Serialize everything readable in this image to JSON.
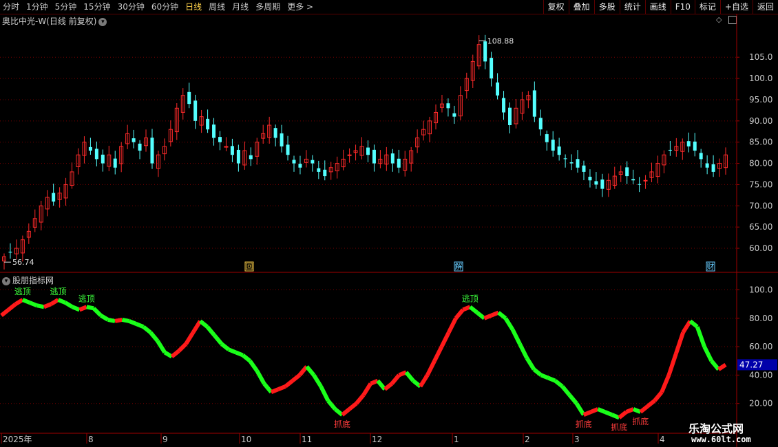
{
  "toolbar": {
    "periods": [
      "分时",
      "1分钟",
      "5分钟",
      "15分钟",
      "30分钟",
      "60分钟",
      "日线",
      "周线",
      "月线",
      "多周期",
      "更多 >"
    ],
    "active_period": "日线",
    "tools": [
      "复权",
      "叠加",
      "多股",
      "统计",
      "画线",
      "F10",
      "标记",
      "+自选",
      "返回"
    ]
  },
  "main_chart": {
    "title": "奥比中光-W(日线 前复权)",
    "y_ticks": [
      "105.0",
      "100.0",
      "95.00",
      "90.00",
      "85.00",
      "80.00",
      "75.00",
      "70.00",
      "65.00",
      "60.00"
    ],
    "max_label": "108.88",
    "min_label": "56.74",
    "markers": [
      {
        "text": "回",
        "color": "#ffd24a"
      },
      {
        "text": "解",
        "color": "#66ccff"
      },
      {
        "text": "财",
        "color": "#66ccff"
      }
    ]
  },
  "indicator": {
    "title": "股朋指标网",
    "y_ticks": [
      "100.0",
      "80.00",
      "60.00",
      "40.00",
      "20.00"
    ],
    "current_value": "47.27",
    "label_top": "逃顶",
    "label_bottom": "抓底"
  },
  "x_axis": {
    "labels": [
      "2025年",
      "8",
      "9",
      "10",
      "11",
      "12",
      "1",
      "2",
      "3",
      "4"
    ]
  },
  "watermark": {
    "line1": "乐淘公式网",
    "line2": "www.60lt.com"
  },
  "colors": {
    "up": "#ff2a2a",
    "down": "#54ffff",
    "ind_up": "#ff1a1a",
    "ind_down": "#1aff1a",
    "grid": "#7a0000",
    "axis": "#a00000"
  },
  "chart_data": [
    {
      "type": "candlestick",
      "title": "奥比中光-W(日线 前复权)",
      "ylim": [
        54.5,
        112
      ],
      "x_labels": [
        "2025年",
        "8",
        "9",
        "10",
        "11",
        "12",
        "1",
        "2",
        "3",
        "4"
      ],
      "close_series": [
        58,
        59,
        60,
        62,
        64,
        67,
        70,
        72,
        71,
        73,
        75,
        78,
        82,
        85,
        83,
        81,
        80,
        82,
        79,
        84,
        87,
        85,
        83,
        86,
        80,
        82,
        84,
        88,
        93,
        96,
        94,
        90,
        91,
        88,
        86,
        85,
        84,
        82,
        80,
        83,
        81,
        85,
        87,
        89,
        86,
        84,
        82,
        80,
        79,
        81,
        80,
        78,
        77,
        79,
        80,
        81,
        82,
        83,
        84,
        82,
        80,
        81,
        82,
        80,
        79,
        81,
        83,
        86,
        88,
        90,
        92,
        94,
        93,
        91,
        96,
        100,
        104,
        108,
        104,
        100,
        96,
        92,
        89,
        93,
        95,
        96,
        91,
        88,
        85,
        83,
        82,
        81,
        80,
        79,
        78,
        76,
        75,
        74,
        76,
        77,
        78,
        77,
        76,
        75,
        76,
        78,
        80,
        82,
        83,
        84,
        85,
        84,
        83,
        81,
        79,
        78,
        80,
        82
      ],
      "max": 108.88,
      "min": 56.74
    },
    {
      "type": "line",
      "title": "股朋指标网",
      "ylim": [
        0,
        108
      ],
      "values": [
        82,
        86,
        90,
        93,
        91,
        89,
        88,
        90,
        93,
        91,
        88,
        86,
        88,
        87,
        82,
        79,
        78,
        79,
        78,
        76,
        74,
        70,
        64,
        56,
        53,
        57,
        62,
        70,
        78,
        74,
        68,
        62,
        58,
        56,
        54,
        50,
        43,
        34,
        28,
        30,
        32,
        36,
        40,
        46,
        40,
        32,
        22,
        16,
        12,
        16,
        20,
        26,
        34,
        36,
        30,
        34,
        40,
        42,
        36,
        32,
        40,
        50,
        60,
        70,
        80,
        86,
        88,
        84,
        80,
        82,
        84,
        80,
        72,
        62,
        52,
        44,
        40,
        38,
        36,
        32,
        26,
        20,
        12,
        14,
        16,
        14,
        12,
        10,
        14,
        16,
        14,
        18,
        22,
        28,
        40,
        55,
        70,
        78,
        74,
        60,
        50,
        44,
        47.27
      ],
      "current": 47.27,
      "annotations": [
        {
          "text": "逃顶",
          "kind": "top"
        },
        {
          "text": "抓底",
          "kind": "bottom"
        }
      ]
    }
  ]
}
